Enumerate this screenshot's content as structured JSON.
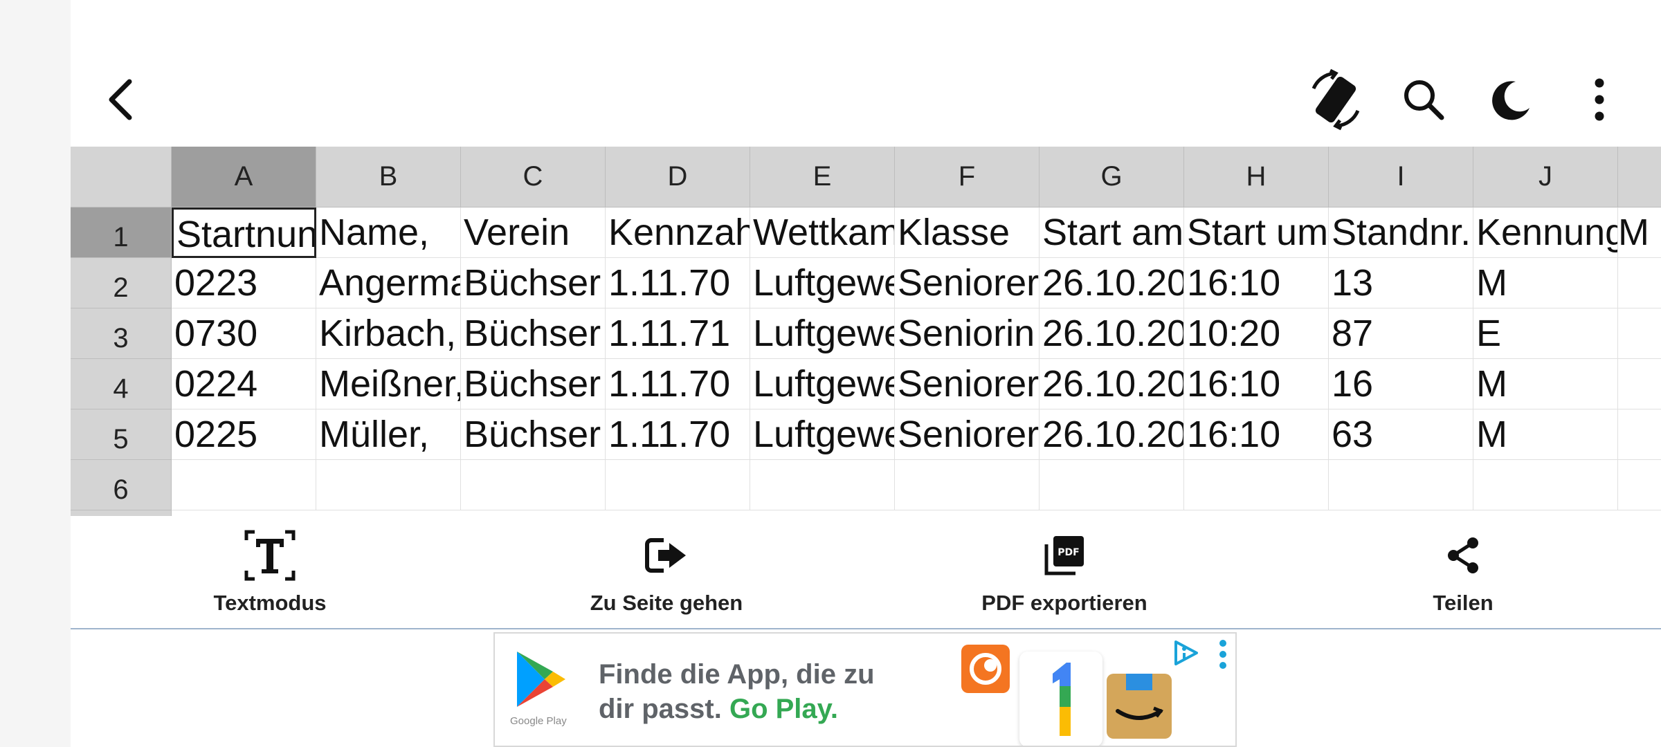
{
  "grid": {
    "columns": [
      "A",
      "B",
      "C",
      "D",
      "E",
      "F",
      "G",
      "H",
      "I",
      "J"
    ],
    "rows": [
      "1",
      "2",
      "3",
      "4",
      "5",
      "6"
    ],
    "cells": [
      [
        "Startnun",
        "Name,",
        "Verein",
        "Kennzah",
        "Wettkam",
        "Klasse",
        "Start am",
        "Start um",
        "Standnr.",
        "Kennung"
      ],
      [
        "0223",
        "Angerma",
        "Büchser",
        "1.11.70",
        "Luftgewe",
        "Seniorer",
        "26.10.20",
        "16:10",
        "13",
        "M"
      ],
      [
        "0730",
        "Kirbach,",
        "Büchser",
        "1.11.71",
        "Luftgewe",
        "Seniorin",
        "26.10.20",
        "10:20",
        "87",
        "E"
      ],
      [
        "0224",
        "Meißner,",
        "Büchser",
        "1.11.70",
        "Luftgewe",
        "Seniorer",
        "26.10.20",
        "16:10",
        "16",
        "M"
      ],
      [
        "0225",
        "Müller,",
        "Büchser",
        "1.11.70",
        "Luftgewe",
        "Seniorer",
        "26.10.20",
        "16:10",
        "63",
        "M"
      ],
      [
        "",
        "",
        "",
        "",
        "",
        "",
        "",
        "",
        "",
        ""
      ]
    ],
    "overflow_j1": "M"
  },
  "toolbar": {
    "text_mode": "Textmodus",
    "go_to_page": "Zu Seite gehen",
    "export_pdf": "PDF exportieren",
    "share": "Teilen"
  },
  "pdf_icon_text": "PDF",
  "ad": {
    "line1": "Finde die App, die zu",
    "line2_prefix": "dir passt. ",
    "line2_accent": "Go Play.",
    "small_label": "Google Play"
  },
  "icons": {
    "back": "back-arrow-icon",
    "rotate": "screen-rotate-icon",
    "search": "search-icon",
    "night": "moon-icon",
    "more": "more-vert-icon",
    "text_mode": "text-mode-icon",
    "go_to_page": "go-to-page-icon",
    "export_pdf": "pdf-export-icon",
    "share": "share-icon"
  },
  "colors": {
    "header_gray": "#d4d4d4",
    "selected_header": "#9e9e9e",
    "ad_accent": "#34a853"
  }
}
